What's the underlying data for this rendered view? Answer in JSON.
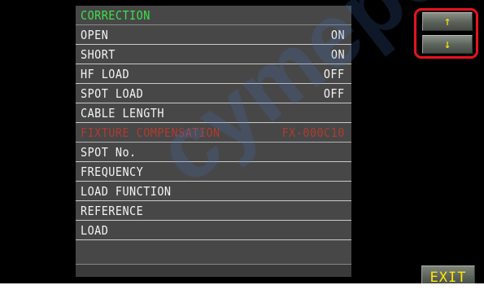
{
  "menu": {
    "header": "CORRECTION",
    "items": [
      {
        "label": "OPEN",
        "value": "ON"
      },
      {
        "label": "SHORT",
        "value": "ON"
      },
      {
        "label": "HF LOAD",
        "value": "OFF"
      },
      {
        "label": "SPOT LOAD",
        "value": "OFF"
      },
      {
        "label": "CABLE LENGTH",
        "value": ""
      },
      {
        "label": "FIXTURE COMPENSATION",
        "value": "FX-000C10"
      },
      {
        "label": "SPOT No.",
        "value": ""
      },
      {
        "label": "FREQUENCY",
        "value": ""
      },
      {
        "label": "LOAD FUNCTION",
        "value": ""
      },
      {
        "label": "REFERENCE",
        "value": ""
      },
      {
        "label": "LOAD",
        "value": ""
      }
    ]
  },
  "buttons": {
    "up_label": "↑",
    "down_label": "↓",
    "exit_label": "EXIT"
  },
  "watermark": {
    "text": "cymepot"
  },
  "colors": {
    "header": "#3ee04a",
    "disabled_item": "#c23a2a",
    "button_text": "#ffe800",
    "highlight": "#e8121f"
  }
}
